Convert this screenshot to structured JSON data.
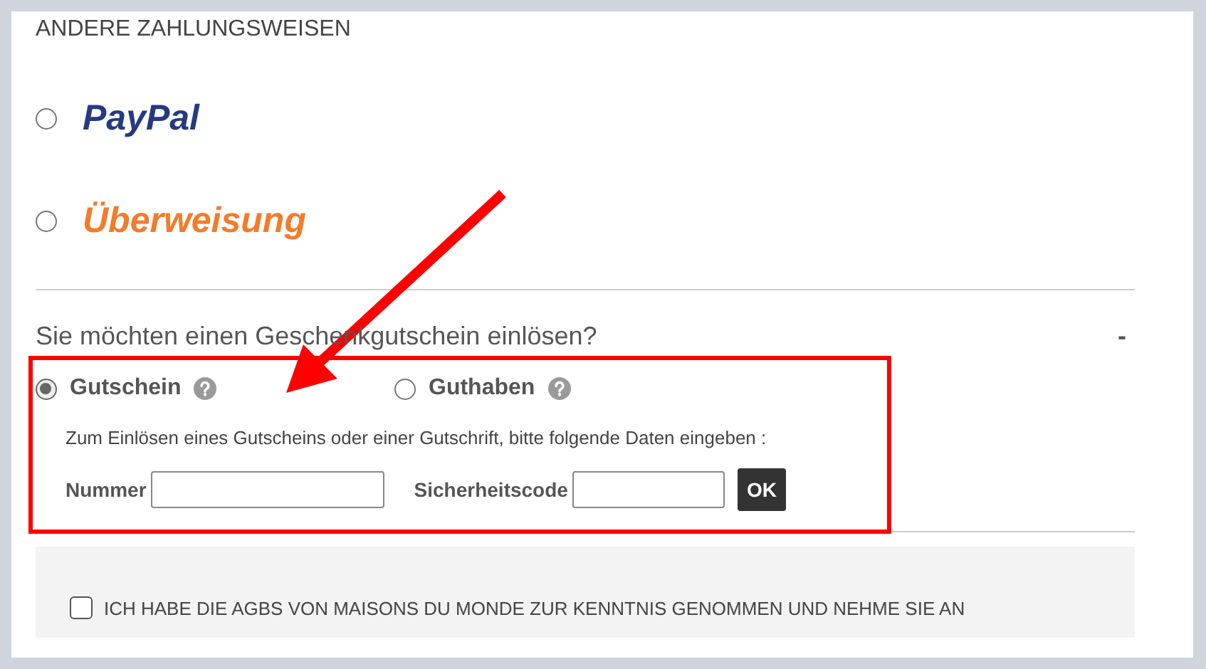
{
  "section_title": "ANDERE ZAHLUNGSWEISEN",
  "payment_methods": [
    {
      "label": "PayPal",
      "color": "#253b80",
      "selected": false
    },
    {
      "label": "Überweisung",
      "color": "#f47b2a",
      "selected": false
    }
  ],
  "voucher": {
    "question": "Sie möchten einen Geschenkgutschein einlösen?",
    "toggle": "-",
    "types": [
      {
        "label": "Gutschein",
        "selected": true
      },
      {
        "label": "Guthaben",
        "selected": false
      }
    ],
    "instructions": "Zum Einlösen eines Gutscheins oder einer Gutschrift, bitte folgende Daten eingeben :",
    "fields": [
      {
        "label": "Nummer"
      },
      {
        "label": "Sicherheitscode"
      }
    ],
    "submit": "OK"
  },
  "terms": {
    "label": "ICH HABE DIE AGBS VON MAISONS DU MONDE ZUR KENNTNIS GENOMMEN UND NEHME SIE AN",
    "checked": false
  }
}
